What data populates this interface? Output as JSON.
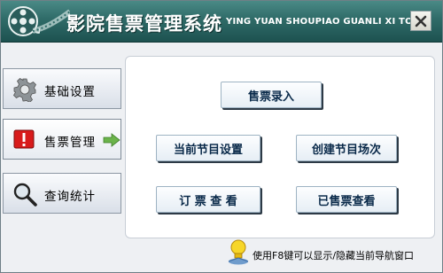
{
  "window": {
    "title": "影院售票管理系统",
    "subtitle": "YING YUAN SHOUPIAO GUANLI XI TONG",
    "close_icon": "close-x-icon"
  },
  "sidebar": {
    "items": [
      {
        "label": "基础设置",
        "icon": "gear-icon"
      },
      {
        "label": "售票管理",
        "icon": "alert-icon",
        "active": true
      },
      {
        "label": "查询统计",
        "icon": "magnifier-icon"
      }
    ]
  },
  "main": {
    "buttons": [
      {
        "label": "售票录入"
      },
      {
        "label": "当前节目设置"
      },
      {
        "label": "创建节目场次"
      },
      {
        "label": "订 票 查 看"
      },
      {
        "label": "已售票查看"
      }
    ]
  },
  "hint": {
    "text": "使用F8键可以显示/隐藏当前导航窗口",
    "icon": "lightbulb-icon"
  },
  "colors": {
    "titlebar": "#2f6b68",
    "button_text": "#0a2a4a",
    "arrow": "#6bb34a"
  }
}
